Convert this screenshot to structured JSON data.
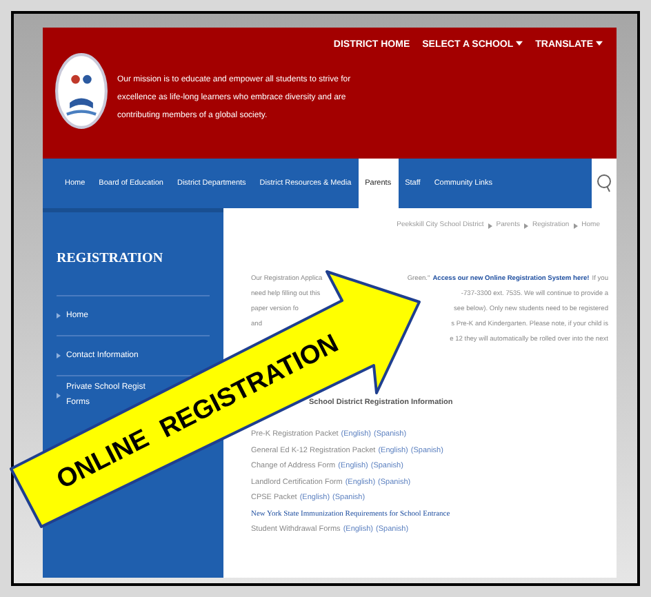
{
  "header": {
    "mission": "Our mission is to educate and empower all students to strive for excellence as life-long learners who embrace diversity and are contributing members of a global society.",
    "top_links": [
      {
        "label": "DISTRICT HOME",
        "dropdown": false
      },
      {
        "label": "SELECT A SCHOOL",
        "dropdown": true
      },
      {
        "label": "TRANSLATE",
        "dropdown": true
      }
    ]
  },
  "nav": {
    "items": [
      {
        "label": "Home",
        "selected": false
      },
      {
        "label": "Board of Education",
        "selected": false
      },
      {
        "label": "District Departments",
        "selected": false
      },
      {
        "label": "District Resources & Media",
        "selected": false
      },
      {
        "label": "Parents",
        "selected": true
      },
      {
        "label": "Staff",
        "selected": false
      },
      {
        "label": "Community Links",
        "selected": false
      }
    ]
  },
  "sidebar": {
    "title": "REGISTRATION",
    "items": [
      {
        "lines": [
          "Home"
        ]
      },
      {
        "lines": [
          "Contact Information"
        ]
      },
      {
        "lines": [
          "Private School Regist",
          "Forms"
        ]
      }
    ]
  },
  "breadcrumb": [
    "Peekskill City School District",
    "Parents",
    "Registration",
    "Home"
  ],
  "intro_lines": [
    {
      "left": "Our Registration Applica",
      "right": "Green.\"",
      "link": "Access our new Online Registration System here!",
      "after": "If you"
    },
    {
      "left": "need help filling out this",
      "right": "-737-3300 ext. 7535. We will continue to provide a"
    },
    {
      "left": "paper version fo",
      "right": "see below). Only new students need to be registered"
    },
    {
      "left": "and",
      "right": "s Pre-K and Kindergarten. Please note, if your child is"
    },
    {
      "right": "e 12 they will automatically be rolled over into the next"
    }
  ],
  "section_heading": "School District Registration Information",
  "documents": [
    {
      "kind": "text",
      "label": "Pre-K Registration Packet",
      "links": [
        "(English)",
        "(Spanish)"
      ]
    },
    {
      "kind": "text",
      "label": "General Ed K-12 Registration Packet",
      "links": [
        "(English)",
        "(Spanish)"
      ]
    },
    {
      "kind": "text",
      "label": "Change of Address Form",
      "links": [
        "(English)",
        "(Spanish)"
      ]
    },
    {
      "kind": "text",
      "label": "Landlord Certification Form",
      "links": [
        "(English)",
        "(Spanish)"
      ]
    },
    {
      "kind": "text",
      "label": "CPSE Packet",
      "links": [
        "(English)",
        "(Spanish)"
      ]
    },
    {
      "kind": "link",
      "label": "New York State Immunization Requirements for School Entrance"
    },
    {
      "kind": "text",
      "label": "Student Withdrawal Forms",
      "links": [
        "(English)",
        "(Spanish)"
      ]
    }
  ],
  "callout": {
    "words": [
      "ONLINE",
      "REGISTRATION"
    ]
  }
}
